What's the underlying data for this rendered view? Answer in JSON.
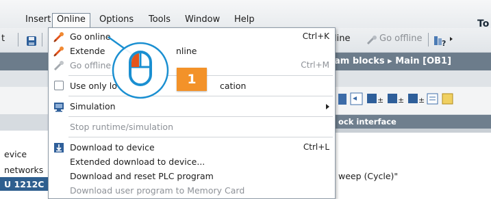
{
  "menubar": {
    "items": [
      "Insert",
      "Online",
      "Options",
      "Tools",
      "Window",
      "Help"
    ],
    "right_text": "To"
  },
  "toolbar": {
    "left_fragment": "t",
    "online_fragment": "line",
    "go_offline": "Go offline"
  },
  "breadcrumb": "am blocks ▸ Main [OB1]",
  "editor": {
    "block_interface_fragment": "ock interface",
    "code_fragment": "weep (Cycle)\""
  },
  "project_tree": {
    "rows": [
      "evice",
      "networks",
      "U 1212C D"
    ],
    "selected_index": 2
  },
  "online_menu": {
    "items": [
      {
        "label": "Go online",
        "shortcut": "Ctrl+K",
        "icon": "go-online-icon",
        "enabled": true
      },
      {
        "label": "Extended go online",
        "shortcut": "",
        "icon": "extended-go-online-icon",
        "enabled": true
      },
      {
        "label": "Go offline",
        "shortcut": "Ctrl+M",
        "icon": "go-offline-icon",
        "enabled": false
      },
      {
        "label": "Use only local network connection for communication",
        "shortcut": "",
        "icon": "checkbox-icon",
        "enabled": true,
        "checked": false
      },
      {
        "label": "Simulation",
        "shortcut": "",
        "icon": "simulation-icon",
        "enabled": true,
        "submenu": true
      },
      {
        "label": "Stop runtime/simulation",
        "shortcut": "",
        "icon": "",
        "enabled": false
      },
      {
        "label": "Download to device",
        "shortcut": "Ctrl+L",
        "icon": "download-icon",
        "enabled": true
      },
      {
        "label": "Extended download to device...",
        "shortcut": "",
        "icon": "",
        "enabled": true
      },
      {
        "label": "Download and reset PLC program",
        "shortcut": "",
        "icon": "",
        "enabled": true
      },
      {
        "label": "Download user program to Memory Card",
        "shortcut": "",
        "icon": "",
        "enabled": false
      }
    ],
    "visible_labels": {
      "go_online": "Go online",
      "extended": "Extende",
      "extended_tail": "nline",
      "go_offline": "Go offline",
      "use_local_a": "Use only lo",
      "use_local_b": "cation"
    }
  },
  "overlay": {
    "badge_number": "1",
    "accent": "#f39229",
    "mouse_color": "#1a8fd1"
  }
}
